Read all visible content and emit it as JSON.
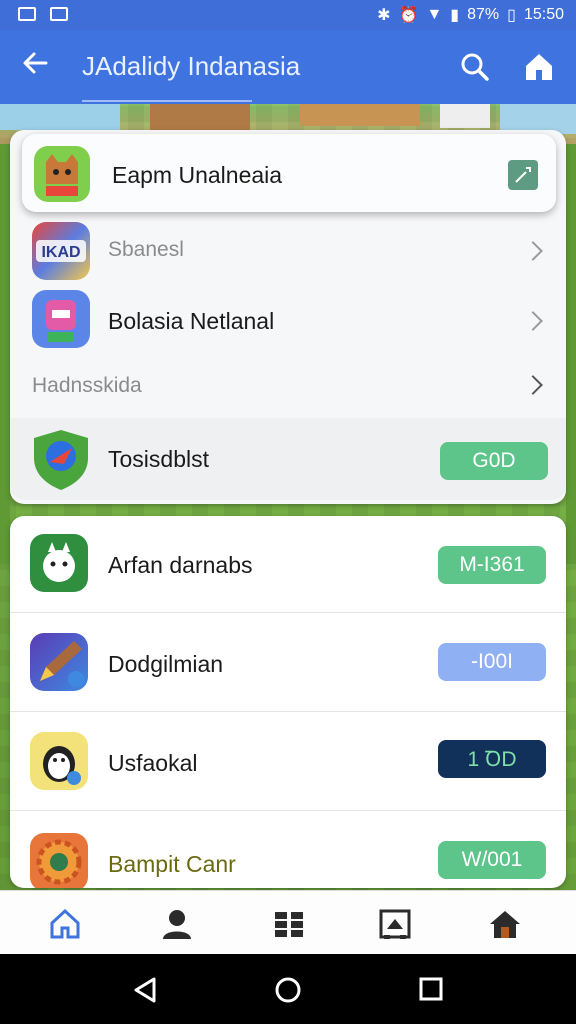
{
  "status_bar": {
    "battery": "87%",
    "time": "15:50"
  },
  "app_bar": {
    "title": "JAdalidy Indanasia",
    "back_icon": "arrow-left-icon",
    "search_icon": "search-icon",
    "home_icon": "home-icon"
  },
  "featured": {
    "label": "Eapm Unalneaia",
    "icon": "fox-game-icon",
    "action_icon": "edit-icon"
  },
  "menu": [
    {
      "label": "Sbanesl",
      "icon": "game-logo-icon"
    },
    {
      "label": "Bolasia Netlanal",
      "icon": "pink-character-icon"
    },
    {
      "label": "Hadnsskida"
    }
  ],
  "installed": {
    "label": "Tosisdblst",
    "icon": "shield-compass-icon",
    "button": "G0D"
  },
  "apps": [
    {
      "label": "Arfan darnabs",
      "icon": "bunny-game-icon",
      "button": "M-I361",
      "color": "#5dc48a"
    },
    {
      "label": "Dodgilmian",
      "icon": "pencil-app-icon",
      "button": "-I00I",
      "color": "#8fb0f3"
    },
    {
      "label": "Usfaokal",
      "icon": "penguin-app-icon",
      "button": "1 ꝹD",
      "color": "#12315a"
    },
    {
      "label": "Bampit Canr",
      "icon": "gear-game-icon",
      "button": "W/001",
      "color": "#5dc48a",
      "label_color": "#6a6a12"
    }
  ],
  "bottom_nav": [
    "home-icon",
    "profile-icon",
    "grid-icon",
    "store-icon",
    "house-icon"
  ],
  "system_nav": [
    "back-triangle-icon",
    "home-circle-icon",
    "recents-square-icon"
  ]
}
